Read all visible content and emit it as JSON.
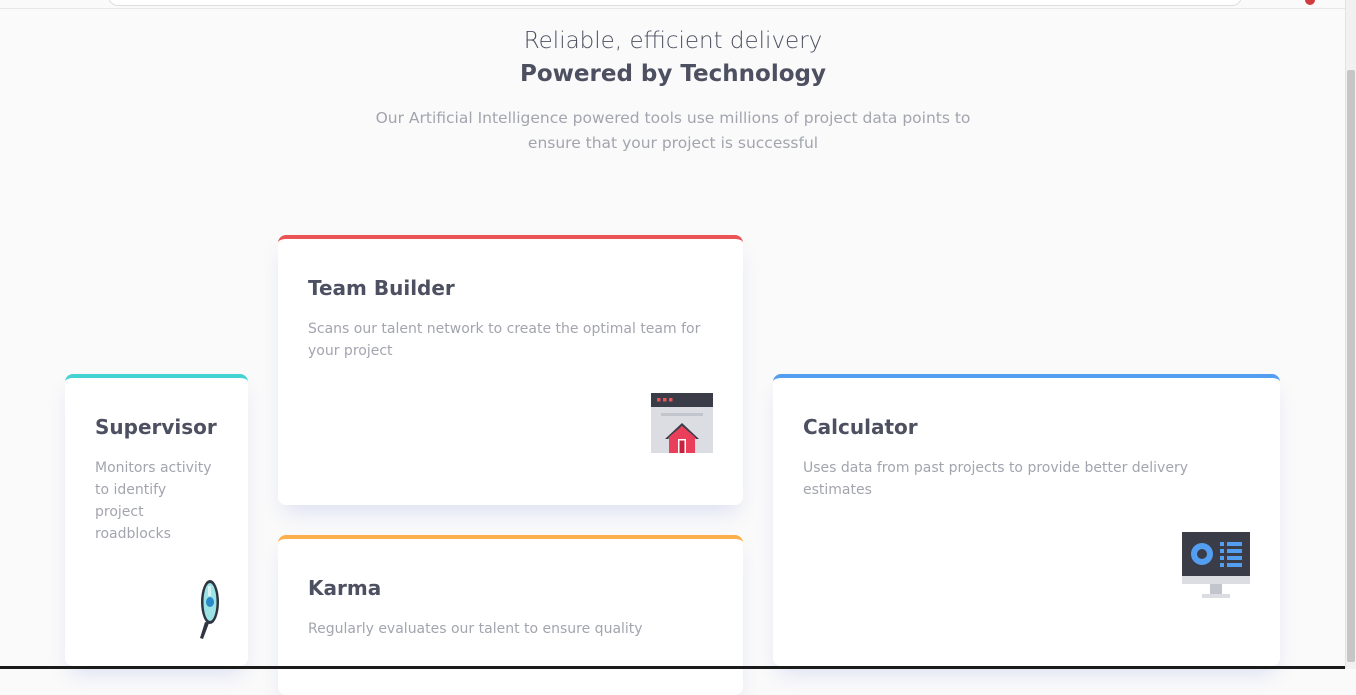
{
  "hero": {
    "subtitle": "Reliable, efficient delivery",
    "title": "Powered by Technology",
    "description": "Our Artificial Intelligence powered tools use millions of project data points to ensure that your project is successful"
  },
  "cards": {
    "supervisor": {
      "title": "Supervisor",
      "description": "Monitors activity to identify project roadblocks",
      "accent": "#44d3d2",
      "icon": "magnifier-icon"
    },
    "team_builder": {
      "title": "Team Builder",
      "description": "Scans our talent network to create the optimal team for your project",
      "accent": "#ea5454",
      "icon": "browser-house-icon"
    },
    "karma": {
      "title": "Karma",
      "description": "Regularly evaluates our talent to ensure quality",
      "accent": "#fcaf4a",
      "icon": "lightbulb-icon"
    },
    "calculator": {
      "title": "Calculator",
      "description": "Uses data from past projects to provide better delivery estimates",
      "accent": "#549ef2",
      "icon": "monitor-icon"
    }
  }
}
